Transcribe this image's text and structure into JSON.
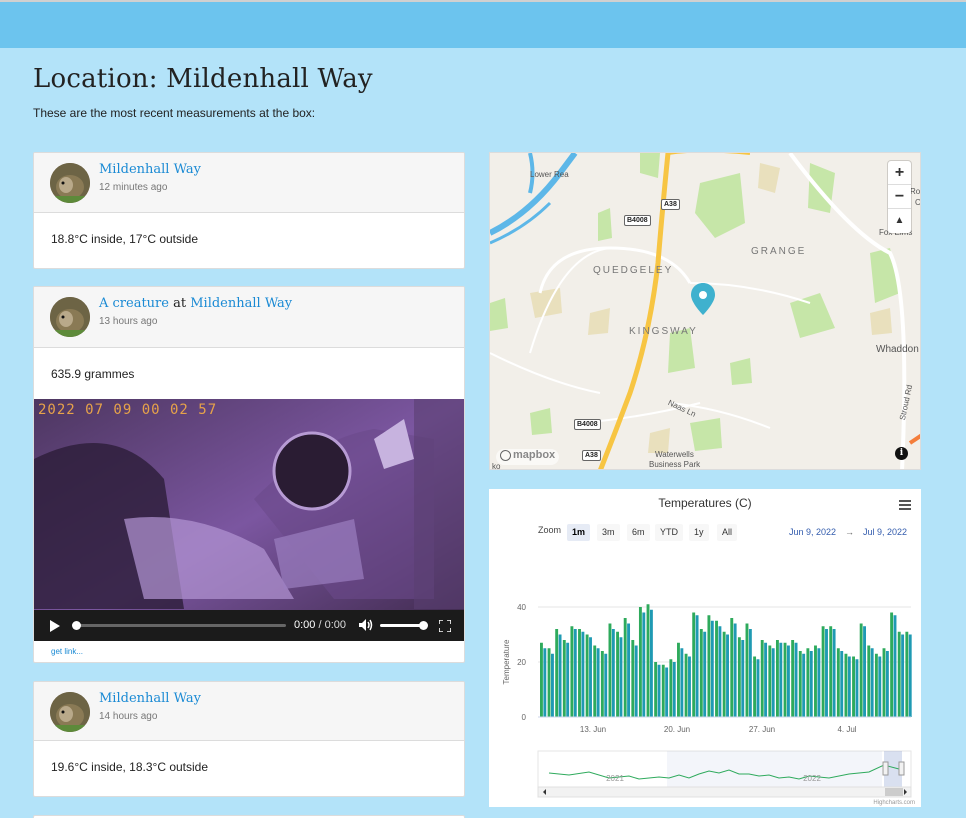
{
  "page": {
    "title": "Location: Mildenhall Way",
    "subtitle": "These are the most recent measurements at the box:"
  },
  "cards": [
    {
      "location": "Mildenhall Way",
      "time": "12 minutes ago",
      "body": "18.8°C inside, 17°C outside"
    },
    {
      "creature": "A creature",
      "at": "at",
      "location": "Mildenhall Way",
      "time": "13 hours ago",
      "body": "635.9 grammes",
      "video": {
        "timestamp": "2022 07 09 00 02 57",
        "time_display": "0:00",
        "separator": "/",
        "duration": "0:00",
        "progress": 0,
        "volume": 1.0
      },
      "link": "get link..."
    },
    {
      "location": "Mildenhall Way",
      "time": "14 hours ago",
      "body": "19.6°C inside, 18.3°C outside"
    }
  ],
  "map": {
    "labels": {
      "lower_rea": "Lower Rea",
      "quedgeley": "QUEDGELEY",
      "grange": "GRANGE",
      "kingsway": "KINGSWAY",
      "whaddon": "Whaddon",
      "fox_elms": "Fox Elms",
      "naas_ln": "Naas Ln",
      "stroud_rd": "Stroud Rd",
      "waterwells1": "Waterwells",
      "waterwells2": "Business Park",
      "ro": "Ro",
      "c": "C",
      "ko": "ko"
    },
    "roads": {
      "a38_top": "A38",
      "b4008_top": "B4008",
      "b4008_bottom": "B4008",
      "a38_bottom": "A38"
    },
    "attribution": "mapbox",
    "info_icon": "i",
    "zoom_in": "+",
    "zoom_out": "−",
    "compass": "▲",
    "marker_icon": "map-pin",
    "colors": {
      "park": "#c6e6a8",
      "road_major": "#f7c543",
      "water": "#5db7e8",
      "sand": "#e9e0bd"
    }
  },
  "chart_data": {
    "type": "bar",
    "title": "Temperatures (C)",
    "ylabel": "Temperature",
    "ylim": [
      0,
      40
    ],
    "yticks": [
      "0",
      "20",
      "40"
    ],
    "xticks": [
      "13. Jun",
      "20. Jun",
      "27. Jun",
      "4. Jul"
    ],
    "range_selector": {
      "zoom_label": "Zoom",
      "buttons": [
        "1m",
        "3m",
        "6m",
        "YTD",
        "1y",
        "All"
      ],
      "active": "1m"
    },
    "date_range": {
      "from": "Jun 9, 2022",
      "arrow": "→",
      "to": "Jul 9, 2022"
    },
    "navigator_labels": [
      "2021",
      "2022"
    ],
    "credits": "Highcharts.com",
    "series": [
      {
        "color": "#2eaa5c",
        "values": [
          27,
          25,
          32,
          28,
          33,
          32,
          30,
          26,
          24,
          34,
          31,
          36,
          28,
          40,
          41,
          20,
          19,
          21,
          27,
          23,
          38,
          32,
          37,
          35,
          31,
          36,
          29,
          34,
          22,
          28,
          26,
          28,
          27,
          28,
          24,
          25,
          26,
          33,
          33,
          25,
          23,
          22,
          34,
          26,
          23,
          25,
          38,
          31,
          31
        ]
      },
      {
        "color": "#1f9ab3",
        "values": [
          25,
          23,
          30,
          27,
          32,
          31,
          29,
          25,
          23,
          32,
          29,
          34,
          26,
          38,
          39,
          19,
          18,
          20,
          25,
          22,
          37,
          31,
          35,
          33,
          30,
          34,
          28,
          32,
          21,
          27,
          25,
          27,
          26,
          27,
          23,
          24,
          25,
          32,
          32,
          24,
          22,
          21,
          33,
          25,
          22,
          24,
          37,
          30,
          30
        ]
      }
    ]
  }
}
